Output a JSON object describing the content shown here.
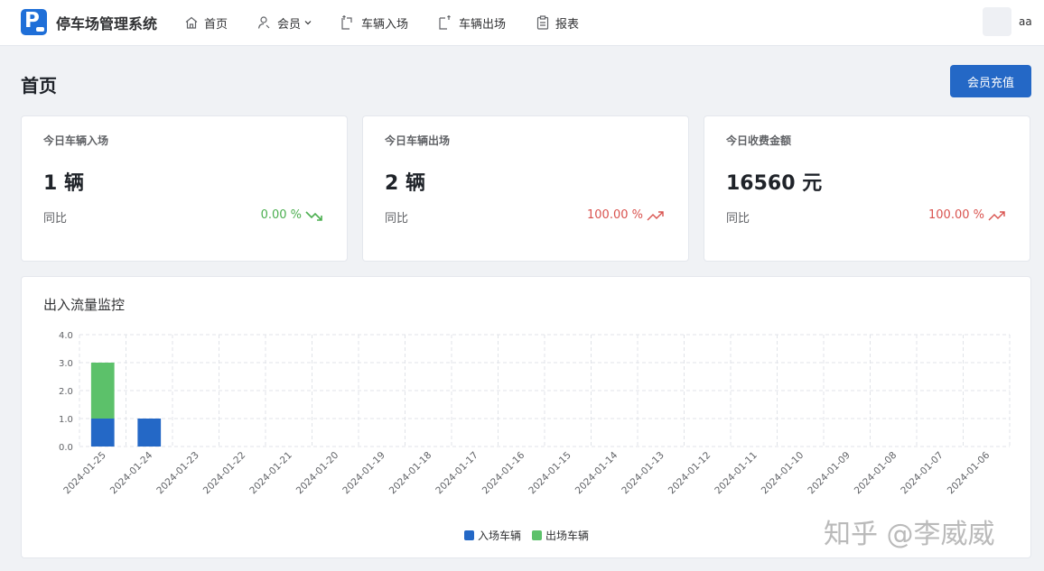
{
  "app": {
    "title": "停车场管理系统"
  },
  "nav": {
    "home": "首页",
    "member": "会员",
    "vehicle_in": "车辆入场",
    "vehicle_out": "车辆出场",
    "report": "报表"
  },
  "user": {
    "name": "aa"
  },
  "page": {
    "title": "首页",
    "recharge_button": "会员充值"
  },
  "stats": [
    {
      "label": "今日车辆入场",
      "value": "1 辆",
      "yoy_label": "同比",
      "yoy": "0.00 %",
      "trend": "down"
    },
    {
      "label": "今日车辆出场",
      "value": "2 辆",
      "yoy_label": "同比",
      "yoy": "100.00 %",
      "trend": "up"
    },
    {
      "label": "今日收费金额",
      "value": "16560 元",
      "yoy_label": "同比",
      "yoy": "100.00 %",
      "trend": "up"
    }
  ],
  "colors": {
    "primary": "#2468c6",
    "in_series": "#2468c6",
    "out_series": "#5cc16a",
    "up": "#d9534f",
    "down": "#4caf50"
  },
  "chart_title": "出入流量监控",
  "chart_data": {
    "type": "bar",
    "stacked": true,
    "categories": [
      "2024-01-25",
      "2024-01-24",
      "2024-01-23",
      "2024-01-22",
      "2024-01-21",
      "2024-01-20",
      "2024-01-19",
      "2024-01-18",
      "2024-01-17",
      "2024-01-16",
      "2024-01-15",
      "2024-01-14",
      "2024-01-13",
      "2024-01-12",
      "2024-01-11",
      "2024-01-10",
      "2024-01-09",
      "2024-01-08",
      "2024-01-07",
      "2024-01-06"
    ],
    "series": [
      {
        "name": "入场车辆",
        "values": [
          1,
          1,
          0,
          0,
          0,
          0,
          0,
          0,
          0,
          0,
          0,
          0,
          0,
          0,
          0,
          0,
          0,
          0,
          0,
          0
        ]
      },
      {
        "name": "出场车辆",
        "values": [
          2,
          0,
          0,
          0,
          0,
          0,
          0,
          0,
          0,
          0,
          0,
          0,
          0,
          0,
          0,
          0,
          0,
          0,
          0,
          0
        ]
      }
    ],
    "yticks": [
      "0.0",
      "1.0",
      "2.0",
      "3.0",
      "4.0"
    ],
    "ylim": [
      0,
      4
    ],
    "grid": true,
    "legend": "bottom-center"
  },
  "watermark": "知乎 @李威威"
}
